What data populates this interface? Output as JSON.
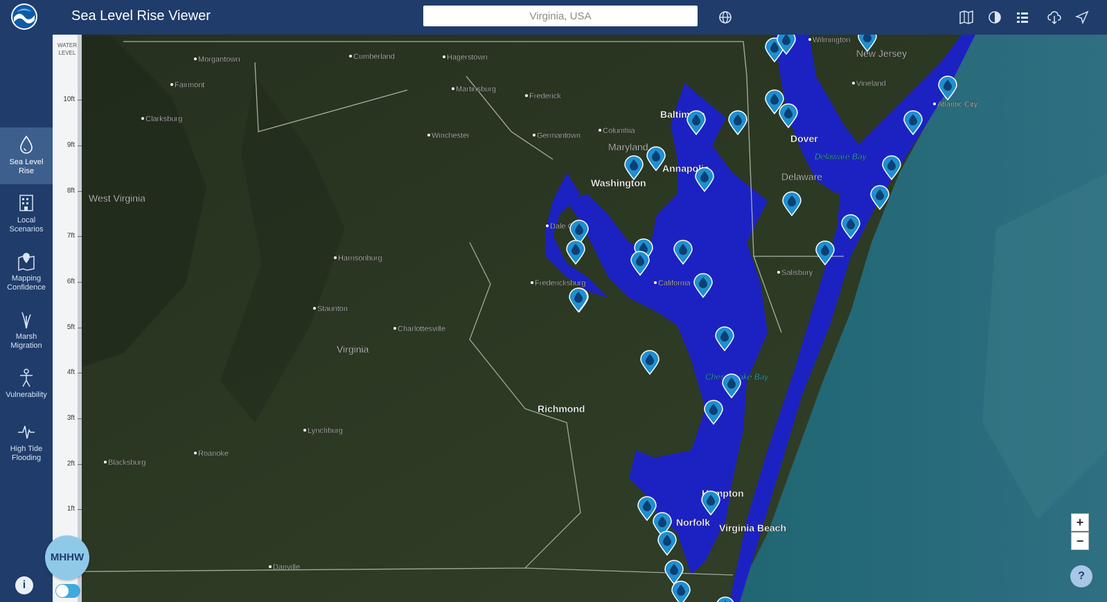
{
  "header": {
    "title": "Sea Level Rise Viewer",
    "search_value": "Virginia, USA",
    "tools": [
      "map-icon",
      "contrast-icon",
      "layers-list-icon",
      "download-cloud-icon",
      "share-arrow-icon"
    ]
  },
  "sidebar": {
    "items": [
      {
        "label": "Sea Level Rise",
        "icon": "water-drop-icon",
        "active": true
      },
      {
        "label": "Local Scenarios",
        "icon": "building-chart-icon",
        "active": false
      },
      {
        "label": "Mapping Confidence",
        "icon": "map-pin-icon",
        "active": false
      },
      {
        "label": "Marsh Migration",
        "icon": "marsh-grass-icon",
        "active": false
      },
      {
        "label": "Vulnerability",
        "icon": "person-icon",
        "active": false
      },
      {
        "label": "High Tide Flooding",
        "icon": "pulse-icon",
        "active": false
      }
    ],
    "info_label": "i"
  },
  "water_level": {
    "title_line1": "WATER",
    "title_line2": "LEVEL",
    "ticks": [
      "10ft",
      "9ft",
      "8ft",
      "7ft",
      "6ft",
      "5ft",
      "4ft",
      "3ft",
      "2ft",
      "1ft"
    ],
    "datum_label": "MHHW",
    "current_value_ft": 0
  },
  "map": {
    "labels": [
      {
        "text": "Morgantown",
        "kind": "city"
      },
      {
        "text": "Cumberland",
        "kind": "city"
      },
      {
        "text": "Hagerstown",
        "kind": "city"
      },
      {
        "text": "Fairmont",
        "kind": "city"
      },
      {
        "text": "Martinsburg",
        "kind": "city"
      },
      {
        "text": "Frederick",
        "kind": "city"
      },
      {
        "text": "Clarksburg",
        "kind": "city"
      },
      {
        "text": "Winchester",
        "kind": "city"
      },
      {
        "text": "Germantown",
        "kind": "city"
      },
      {
        "text": "Columbia",
        "kind": "city"
      },
      {
        "text": "Maryland",
        "kind": "state"
      },
      {
        "text": "Washington",
        "kind": "major"
      },
      {
        "text": "Annapolis",
        "kind": "major"
      },
      {
        "text": "West Virginia",
        "kind": "state"
      },
      {
        "text": "Dale City",
        "kind": "city"
      },
      {
        "text": "Harrisonburg",
        "kind": "city"
      },
      {
        "text": "Fredericksburg",
        "kind": "city"
      },
      {
        "text": "California",
        "kind": "city"
      },
      {
        "text": "Staunton",
        "kind": "city"
      },
      {
        "text": "Charlottesville",
        "kind": "city"
      },
      {
        "text": "Virginia",
        "kind": "state"
      },
      {
        "text": "Richmond",
        "kind": "major"
      },
      {
        "text": "Lynchburg",
        "kind": "city"
      },
      {
        "text": "Roanoke",
        "kind": "city"
      },
      {
        "text": "Blacksburg",
        "kind": "city"
      },
      {
        "text": "Danville",
        "kind": "city"
      },
      {
        "text": "Hampton",
        "kind": "major"
      },
      {
        "text": "Norfolk",
        "kind": "major"
      },
      {
        "text": "Virginia Beach",
        "kind": "major"
      },
      {
        "text": "Salisbury",
        "kind": "city"
      },
      {
        "text": "Dover",
        "kind": "major"
      },
      {
        "text": "Delaware",
        "kind": "state"
      },
      {
        "text": "Delaware Bay",
        "kind": "water"
      },
      {
        "text": "Chesapeake Bay",
        "kind": "water"
      },
      {
        "text": "New Jersey",
        "kind": "state"
      },
      {
        "text": "Vineland",
        "kind": "city"
      },
      {
        "text": "Atlantic City",
        "kind": "city"
      },
      {
        "text": "Wilmington",
        "kind": "city"
      },
      {
        "text": "Baltimore",
        "kind": "major"
      }
    ],
    "gauge_count": 36,
    "zoom_in": "+",
    "zoom_out": "−",
    "help": "?"
  },
  "colors": {
    "header_bg": "#1f3c6b",
    "active_nav": "#3c5f8d",
    "water": "#1c22c2",
    "marker": "#1e8fd0",
    "ocean": "#1d5a68"
  }
}
